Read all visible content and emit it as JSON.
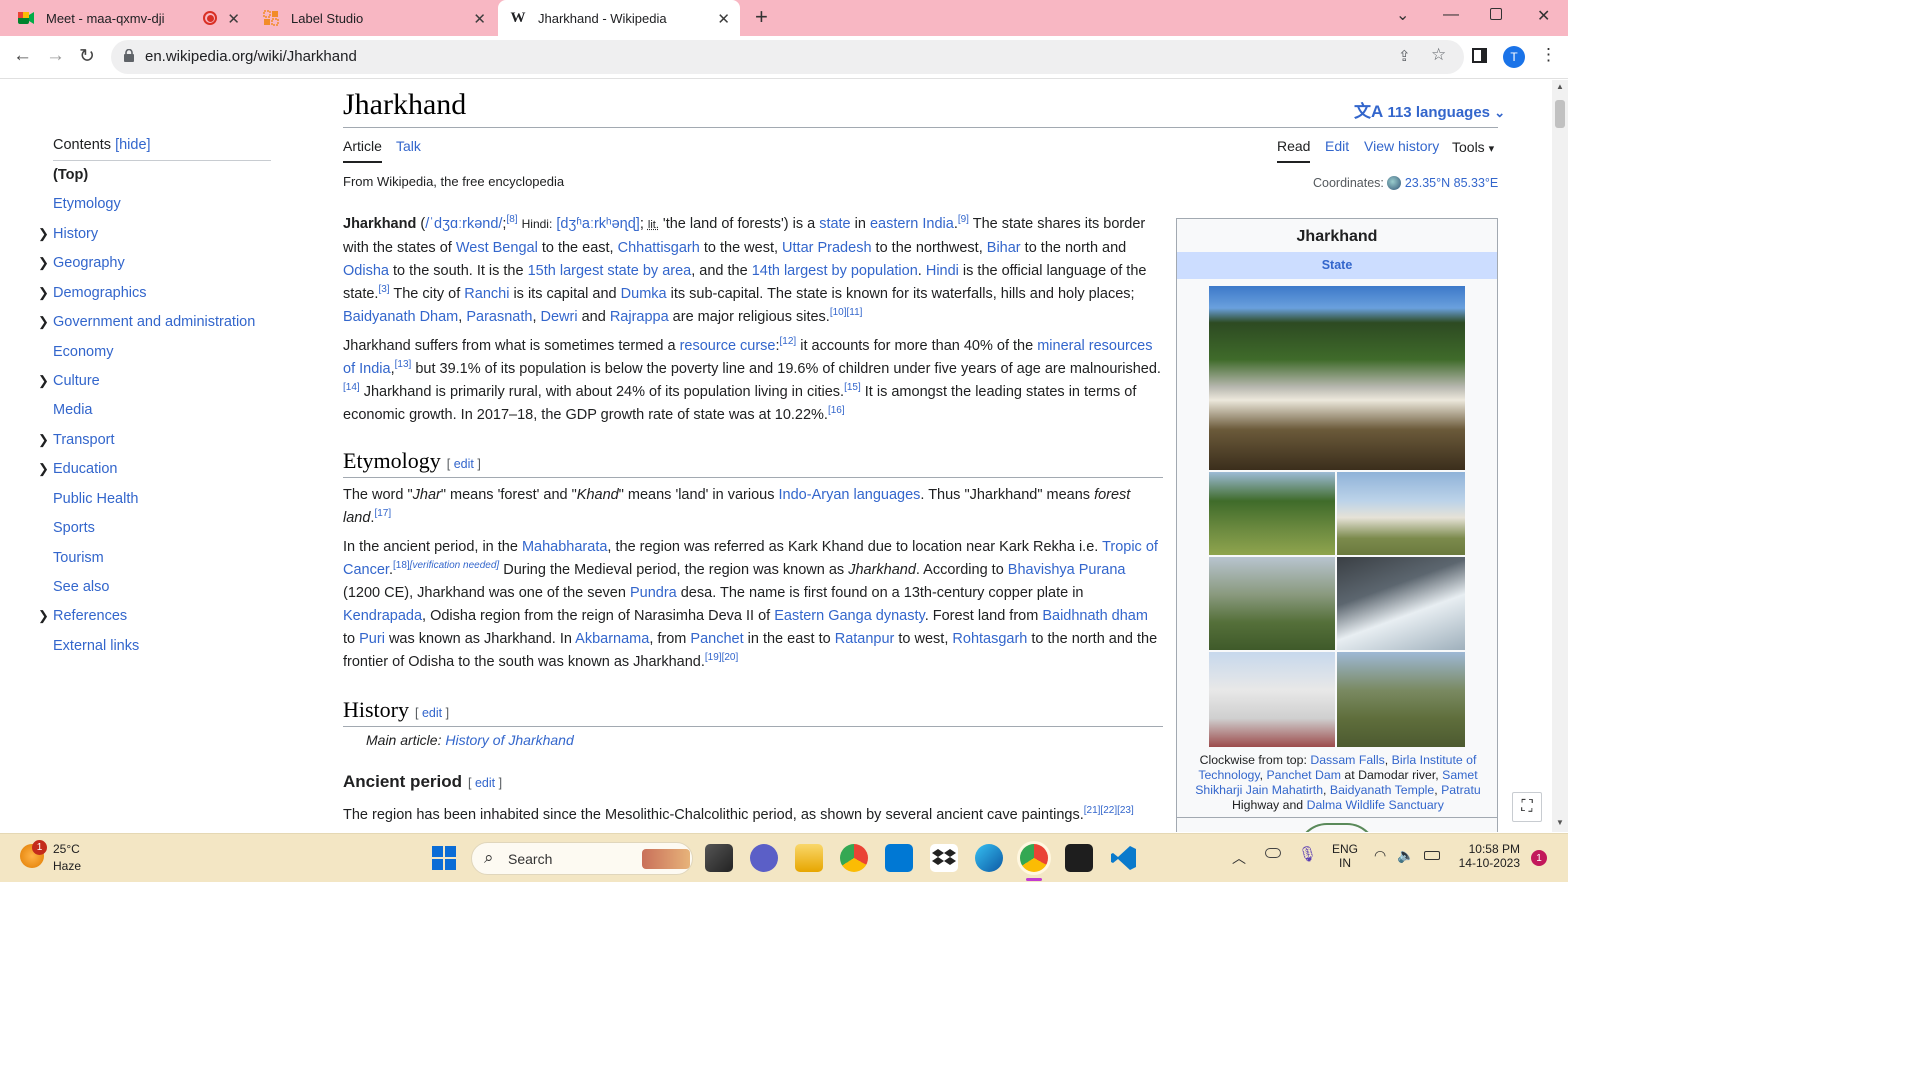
{
  "browser": {
    "tabs": [
      {
        "title": "Meet - maa-qxmv-dji",
        "active": false,
        "recording": true
      },
      {
        "title": "Label Studio",
        "active": false
      },
      {
        "title": "Jharkhand - Wikipedia",
        "active": true
      }
    ],
    "url": "en.wikipedia.org/wiki/Jharkhand",
    "profile_initial": "T"
  },
  "wiki": {
    "title": "Jharkhand",
    "languages": "113 languages",
    "tabs_left": [
      "Article",
      "Talk"
    ],
    "tabs_right": [
      "Read",
      "Edit",
      "View history",
      "Tools"
    ],
    "tagline": "From Wikipedia, the free encyclopedia",
    "coordinates_label": "Coordinates:",
    "coordinates_value": "23.35°N 85.33°E",
    "toc": {
      "heading": "Contents",
      "hide": "[hide]",
      "items": [
        {
          "label": "(Top)",
          "expandable": false
        },
        {
          "label": "Etymology",
          "expandable": false
        },
        {
          "label": "History",
          "expandable": true
        },
        {
          "label": "Geography",
          "expandable": true
        },
        {
          "label": "Demographics",
          "expandable": true
        },
        {
          "label": "Government and administration",
          "expandable": true
        },
        {
          "label": "Economy",
          "expandable": false
        },
        {
          "label": "Culture",
          "expandable": true
        },
        {
          "label": "Media",
          "expandable": false
        },
        {
          "label": "Transport",
          "expandable": true
        },
        {
          "label": "Education",
          "expandable": true
        },
        {
          "label": "Public Health",
          "expandable": false
        },
        {
          "label": "Sports",
          "expandable": false
        },
        {
          "label": "Tourism",
          "expandable": false
        },
        {
          "label": "See also",
          "expandable": false
        },
        {
          "label": "References",
          "expandable": true
        },
        {
          "label": "External links",
          "expandable": false
        }
      ]
    },
    "sections": {
      "etymology": "Etymology",
      "history": "History",
      "ancient": "Ancient period",
      "edit": "edit",
      "main_article_prefix": "Main article: ",
      "main_article_link": "History of Jharkhand",
      "last_line": "The region has been inhabited since the Mesolithic-Chalcolithic period, as shown by several ancient cave paintings."
    },
    "infobox": {
      "title": "Jharkhand",
      "subtitle": "State",
      "caption_prefix": "Clockwise from top:",
      "caption_links": [
        "Dassam Falls",
        "Birla Institute of Technology",
        "Panchet Dam",
        "Samet Shikharji Jain Mahatirth",
        "Baidyanath Temple",
        "Patratu"
      ],
      "caption_text": [
        "at Damodar river,",
        "Highway and"
      ],
      "caption_last": "Dalma Wildlife Sanctuary"
    }
  },
  "taskbar": {
    "weather_temp": "25°C",
    "weather_desc": "Haze",
    "weather_badge": "1",
    "search": "Search",
    "lang": "ENG",
    "region": "IN",
    "time": "10:58 PM",
    "date": "14-10-2023",
    "notif": "1"
  }
}
